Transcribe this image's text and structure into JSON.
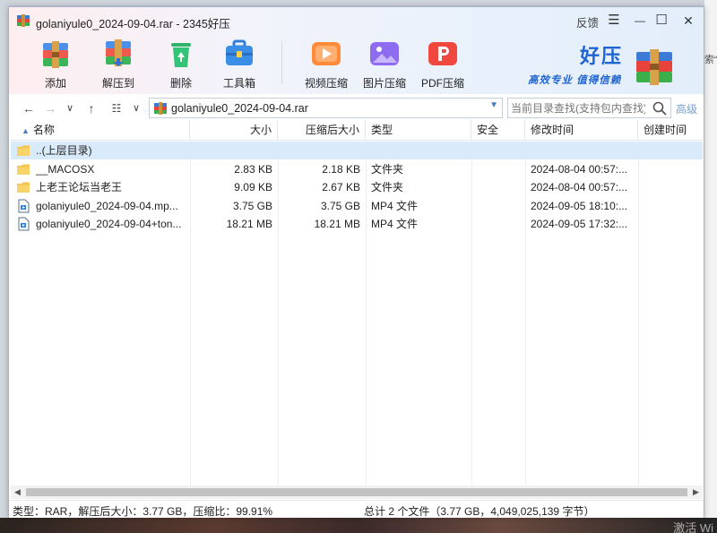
{
  "window": {
    "title": "golaniyule0_2024-09-04.rar - 2345好压",
    "feedback_label": "反馈",
    "menu_glyph": "☰",
    "minimize_glyph": "—",
    "maximize_glyph": "☐",
    "close_glyph": "✕"
  },
  "toolbar": {
    "add_label": "添加",
    "extract_label": "解压到",
    "delete_label": "删除",
    "toolbox_label": "工具箱",
    "video_compress_label": "视频压缩",
    "image_compress_label": "图片压缩",
    "pdf_compress_label": "PDF压缩"
  },
  "brand": {
    "name": "好压",
    "slogan": "高效专业 值得信赖"
  },
  "navigation": {
    "back_glyph": "←",
    "forward_glyph": "→",
    "history_glyph": "∨",
    "up_glyph": "↑",
    "view_glyph": "☷",
    "view_dropdown_glyph": "∨",
    "address": "golaniyule0_2024-09-04.rar",
    "address_dropdown": "▼",
    "search_placeholder": "当前目录查找(支持包内查找)",
    "advanced_label": "高级"
  },
  "columns": {
    "name": "名称",
    "size": "大小",
    "packed": "压缩后大小",
    "type": "类型",
    "security": "安全",
    "modified": "修改时间",
    "created": "创建时间",
    "sort_arrow": "▲"
  },
  "files": [
    {
      "name": "..(上层目录)",
      "size": "",
      "packed": "",
      "type": "",
      "security": "",
      "modified": "",
      "created": "",
      "icon": "folder-icon"
    },
    {
      "name": "__MACOSX",
      "size": "2.83 KB",
      "packed": "2.18 KB",
      "type": "文件夹",
      "security": "",
      "modified": "2024-08-04 00:57:...",
      "created": "",
      "icon": "folder-icon"
    },
    {
      "name": "上老王论坛当老王",
      "size": "9.09 KB",
      "packed": "2.67 KB",
      "type": "文件夹",
      "security": "",
      "modified": "2024-08-04 00:57:...",
      "created": "",
      "icon": "folder-icon"
    },
    {
      "name": "golaniyule0_2024-09-04.mp...",
      "size": "3.75 GB",
      "packed": "3.75 GB",
      "type": "MP4 文件",
      "security": "",
      "modified": "2024-09-05 18:10:...",
      "created": "",
      "icon": "video-file-icon"
    },
    {
      "name": "golaniyule0_2024-09-04+ton...",
      "size": "18.21 MB",
      "packed": "18.21 MB",
      "type": "MP4 文件",
      "security": "",
      "modified": "2024-09-05 17:32:...",
      "created": "",
      "icon": "video-file-icon"
    }
  ],
  "scrollbar": {
    "left_arrow": "◀",
    "right_arrow": "▶"
  },
  "status": {
    "left": "类型：RAR，解压后大小：3.77 GB，压缩比：99.91%",
    "middle": "总计 2 个文件（3.77 GB，4,049,025,139 字节）"
  },
  "desktop": {
    "side_text": "索“",
    "watermark": "激活 Wi"
  },
  "colors": {
    "accent": "#1f64d2",
    "selection": "#d9ebfb",
    "folder": "#f4c64e"
  }
}
